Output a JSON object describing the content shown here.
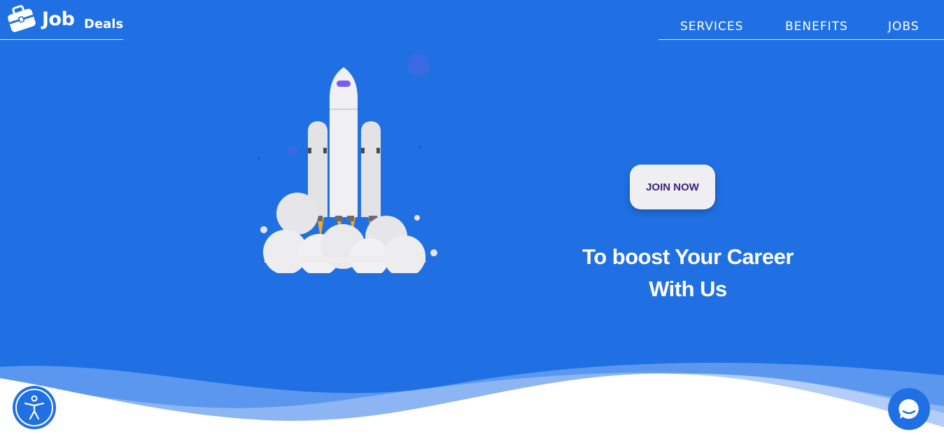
{
  "brand": {
    "name_primary": "Job",
    "name_secondary": "Deals",
    "icon": "briefcase-icon"
  },
  "nav": {
    "items": [
      {
        "label": "SERVICES"
      },
      {
        "label": "BENEFITS"
      },
      {
        "label": "JOBS"
      }
    ]
  },
  "hero": {
    "cta_label": "JOIN NOW",
    "tagline_line1": "To boost Your Career",
    "tagline_line2": "With Us",
    "illustration": "rocket-launch-illustration"
  },
  "widgets": {
    "accessibility_icon": "accessibility-icon",
    "chat_icon": "chat-bubble-icon"
  },
  "colors": {
    "background": "#2070e4",
    "button_bg": "#efeff2",
    "button_text": "#3e1c7a",
    "text": "#ffffff"
  }
}
